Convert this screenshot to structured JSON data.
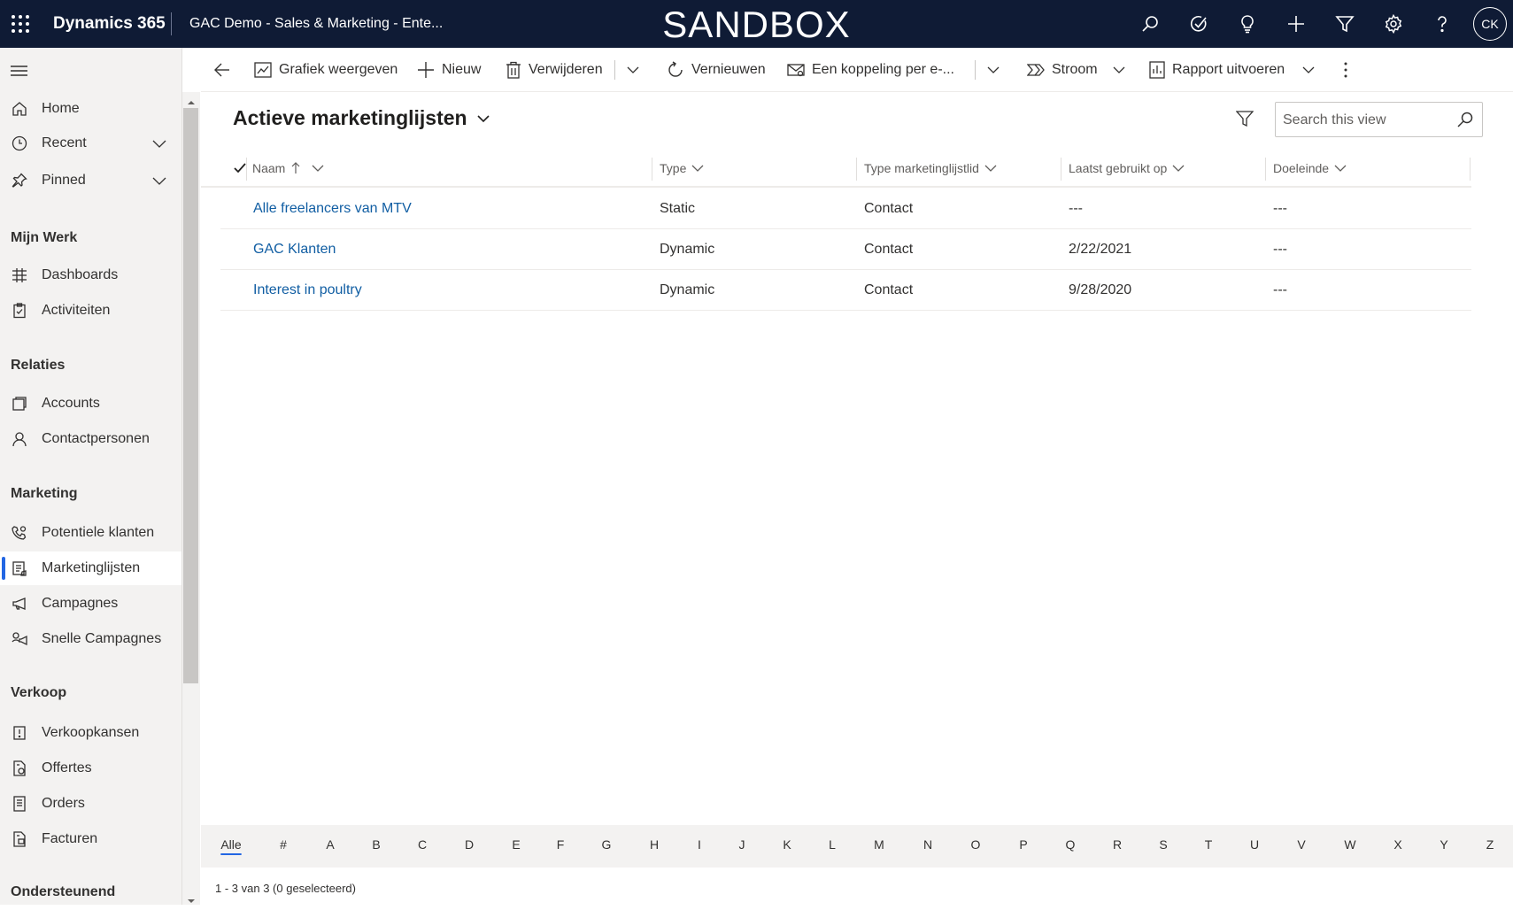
{
  "topbar": {
    "app_name": "Dynamics 365",
    "env_name": "GAC Demo - Sales & Marketing - Ente...",
    "banner": "SANDBOX",
    "avatar_initials": "CK",
    "icons": [
      "search-icon",
      "task-check-icon",
      "lightbulb-icon",
      "plus-icon",
      "filter-icon",
      "gear-icon",
      "help-icon"
    ]
  },
  "sidebar": {
    "home": "Home",
    "recent": "Recent",
    "pinned": "Pinned",
    "section_work": "Mijn Werk",
    "dashboards": "Dashboards",
    "activities": "Activiteiten",
    "section_relations": "Relaties",
    "accounts": "Accounts",
    "contacts": "Contactpersonen",
    "section_marketing": "Marketing",
    "leads": "Potentiele klanten",
    "marketing_lists": "Marketinglijsten",
    "campaigns": "Campagnes",
    "quick_campaigns": "Snelle Campagnes",
    "section_sales": "Verkoop",
    "opportunities": "Verkoopkansen",
    "quotes": "Offertes",
    "orders": "Orders",
    "invoices": "Facturen",
    "section_support": "Ondersteunend"
  },
  "commandbar": {
    "show_chart": "Grafiek weergeven",
    "new": "Nieuw",
    "delete": "Verwijderen",
    "refresh": "Vernieuwen",
    "email_link": "Een koppeling per e-...",
    "flow": "Stroom",
    "run_report": "Rapport uitvoeren"
  },
  "view": {
    "title": "Actieve marketinglijsten",
    "search_placeholder": "Search this view"
  },
  "grid": {
    "columns": [
      "Naam",
      "Type",
      "Type marketinglijstlid",
      "Laatst gebruikt op",
      "Doeleinde"
    ],
    "rows": [
      {
        "name": "Alle freelancers van MTV",
        "type": "Static",
        "member_type": "Contact",
        "last_used": "---",
        "purpose": "---"
      },
      {
        "name": "GAC Klanten",
        "type": "Dynamic",
        "member_type": "Contact",
        "last_used": "2/22/2021",
        "purpose": "---"
      },
      {
        "name": "Interest in poultry",
        "type": "Dynamic",
        "member_type": "Contact",
        "last_used": "9/28/2020",
        "purpose": "---"
      }
    ]
  },
  "alphabet": [
    "Alle",
    "#",
    "A",
    "B",
    "C",
    "D",
    "E",
    "F",
    "G",
    "H",
    "I",
    "J",
    "K",
    "L",
    "M",
    "N",
    "O",
    "P",
    "Q",
    "R",
    "S",
    "T",
    "U",
    "V",
    "W",
    "X",
    "Y",
    "Z"
  ],
  "status": "1 - 3 van 3 (0 geselecteerd)",
  "colors": {
    "topbar": "#0f1b35",
    "link": "#115ea3",
    "accent": "#2266e3"
  }
}
